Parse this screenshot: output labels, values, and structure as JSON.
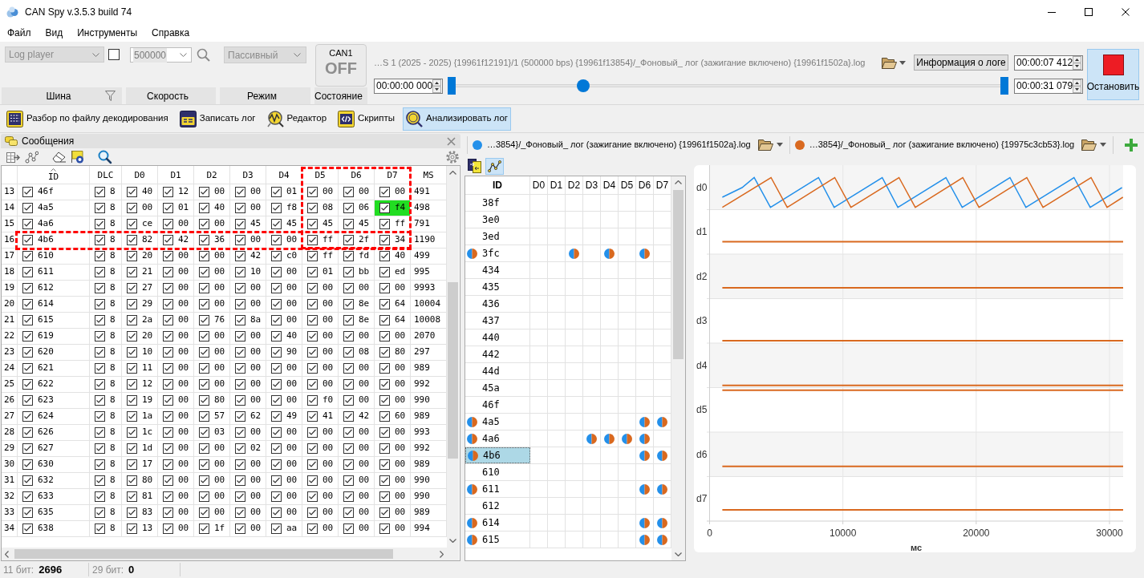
{
  "window": {
    "title": "CAN Spy v.3.5.3 build 74"
  },
  "menu": [
    {
      "label": "Файл"
    },
    {
      "label": "Вид"
    },
    {
      "label": "Инструменты"
    },
    {
      "label": "Справка"
    }
  ],
  "ribbon": {
    "bus": {
      "value": "Log player",
      "disabled": true,
      "checked": false,
      "label": "Шина"
    },
    "speed": {
      "value": "500000",
      "disabled": false,
      "label": "Скорость"
    },
    "mode": {
      "value": "Пассивный",
      "disabled": true,
      "label": "Режим"
    },
    "state": {
      "channel": "CAN1",
      "status": "OFF",
      "on": false,
      "label": "Состояние"
    },
    "player": {
      "path": "…S 1 (2025 - 2025) {19961f12191}/1 (500000 bps) {19961f13854}/_Фоновый_ лог (зажигание включено) {19961f1502a}.log",
      "info_button": "Информация о логе",
      "current_time": "00:00:07 412",
      "start_time": "00:00:00 000",
      "end_time": "00:00:31 079",
      "range_start": {
        "level": 0
      },
      "position": {
        "level": 0.2385
      },
      "range_end": {
        "level": 1
      }
    },
    "stop_button": {
      "label": "Остановить"
    }
  },
  "toolbar": [
    {
      "label": "Разбор по файлу декодирования",
      "kind": "decode",
      "selected": false
    },
    {
      "label": "Записать лог",
      "kind": "record",
      "selected": false
    },
    {
      "label": "Редактор",
      "kind": "editor",
      "selected": false
    },
    {
      "label": "Скрипты",
      "kind": "scripts",
      "selected": false
    },
    {
      "label": "Анализировать лог",
      "kind": "analyze",
      "selected": true
    }
  ],
  "messages": {
    "title": "Сообщения",
    "columns": [
      {
        "label": "ID",
        "sorted": true,
        "outlined": false
      },
      {
        "label": "DLC",
        "sorted": false,
        "outlined": false
      },
      {
        "label": "D0",
        "sorted": false,
        "outlined": false
      },
      {
        "label": "D1",
        "sorted": false,
        "outlined": false
      },
      {
        "label": "D2",
        "sorted": false,
        "outlined": false
      },
      {
        "label": "D3",
        "sorted": false,
        "outlined": false
      },
      {
        "label": "D4",
        "sorted": false,
        "outlined": false
      },
      {
        "label": "D5",
        "sorted": false,
        "outlined": true
      },
      {
        "label": "D6",
        "sorted": false,
        "outlined": true
      },
      {
        "label": "D7",
        "sorted": false,
        "outlined": true
      },
      {
        "label": "MS",
        "sorted": false,
        "outlined": false
      }
    ],
    "rows": [
      {
        "num": "13",
        "id": "46f",
        "dlc": "8",
        "bytes": [
          "40",
          "12",
          "00",
          "00",
          "01",
          "00",
          "00",
          "00"
        ],
        "ms": "491",
        "checked": true,
        "changed": [
          false,
          false,
          false,
          false,
          false,
          false,
          false,
          false
        ],
        "outlined": false
      },
      {
        "num": "14",
        "id": "4a5",
        "dlc": "8",
        "bytes": [
          "00",
          "01",
          "40",
          "00",
          "f8",
          "08",
          "06",
          "f4"
        ],
        "ms": "498",
        "checked": true,
        "changed": [
          false,
          false,
          false,
          false,
          false,
          false,
          false,
          true
        ],
        "outlined": false
      },
      {
        "num": "15",
        "id": "4a6",
        "dlc": "8",
        "bytes": [
          "ce",
          "00",
          "00",
          "45",
          "45",
          "45",
          "45",
          "ff"
        ],
        "ms": "791",
        "checked": true,
        "changed": [
          false,
          false,
          false,
          false,
          false,
          false,
          false,
          false
        ],
        "outlined": false
      },
      {
        "num": "16",
        "id": "4b6",
        "dlc": "8",
        "bytes": [
          "82",
          "42",
          "36",
          "00",
          "00",
          "ff",
          "2f",
          "34"
        ],
        "ms": "1190",
        "checked": true,
        "changed": [
          false,
          false,
          false,
          false,
          false,
          false,
          false,
          false
        ],
        "outlined": true
      },
      {
        "num": "17",
        "id": "610",
        "dlc": "8",
        "bytes": [
          "20",
          "00",
          "00",
          "42",
          "c0",
          "ff",
          "fd",
          "40"
        ],
        "ms": "499",
        "checked": true,
        "changed": [
          false,
          false,
          false,
          false,
          false,
          false,
          false,
          false
        ],
        "outlined": false
      },
      {
        "num": "18",
        "id": "611",
        "dlc": "8",
        "bytes": [
          "21",
          "00",
          "00",
          "10",
          "00",
          "01",
          "bb",
          "ed"
        ],
        "ms": "995",
        "checked": true,
        "changed": [
          false,
          false,
          false,
          false,
          false,
          false,
          false,
          false
        ],
        "outlined": false
      },
      {
        "num": "19",
        "id": "612",
        "dlc": "8",
        "bytes": [
          "27",
          "00",
          "00",
          "00",
          "00",
          "00",
          "00",
          "00"
        ],
        "ms": "9993",
        "checked": true,
        "changed": [
          false,
          false,
          false,
          false,
          false,
          false,
          false,
          false
        ],
        "outlined": false
      },
      {
        "num": "20",
        "id": "614",
        "dlc": "8",
        "bytes": [
          "29",
          "00",
          "00",
          "00",
          "00",
          "00",
          "8e",
          "64"
        ],
        "ms": "10004",
        "checked": true,
        "changed": [
          false,
          false,
          false,
          false,
          false,
          false,
          false,
          false
        ],
        "outlined": false
      },
      {
        "num": "21",
        "id": "615",
        "dlc": "8",
        "bytes": [
          "2a",
          "00",
          "76",
          "8a",
          "00",
          "00",
          "8e",
          "64"
        ],
        "ms": "10008",
        "checked": true,
        "changed": [
          false,
          false,
          false,
          false,
          false,
          false,
          false,
          false
        ],
        "outlined": false
      },
      {
        "num": "22",
        "id": "619",
        "dlc": "8",
        "bytes": [
          "20",
          "00",
          "00",
          "00",
          "40",
          "00",
          "00",
          "00"
        ],
        "ms": "2070",
        "checked": true,
        "changed": [
          false,
          false,
          false,
          false,
          false,
          false,
          false,
          false
        ],
        "outlined": false
      },
      {
        "num": "23",
        "id": "620",
        "dlc": "8",
        "bytes": [
          "10",
          "00",
          "00",
          "00",
          "90",
          "00",
          "08",
          "80"
        ],
        "ms": "297",
        "checked": true,
        "changed": [
          false,
          false,
          false,
          false,
          false,
          false,
          false,
          false
        ],
        "outlined": false
      },
      {
        "num": "24",
        "id": "621",
        "dlc": "8",
        "bytes": [
          "11",
          "00",
          "00",
          "00",
          "00",
          "00",
          "00",
          "00"
        ],
        "ms": "989",
        "checked": true,
        "changed": [
          false,
          false,
          false,
          false,
          false,
          false,
          false,
          false
        ],
        "outlined": false
      },
      {
        "num": "25",
        "id": "622",
        "dlc": "8",
        "bytes": [
          "12",
          "00",
          "00",
          "00",
          "00",
          "00",
          "00",
          "00"
        ],
        "ms": "992",
        "checked": true,
        "changed": [
          false,
          false,
          false,
          false,
          false,
          false,
          false,
          false
        ],
        "outlined": false
      },
      {
        "num": "26",
        "id": "623",
        "dlc": "8",
        "bytes": [
          "19",
          "00",
          "80",
          "00",
          "00",
          "f0",
          "00",
          "00"
        ],
        "ms": "990",
        "checked": true,
        "changed": [
          false,
          false,
          false,
          false,
          false,
          false,
          false,
          false
        ],
        "outlined": false
      },
      {
        "num": "27",
        "id": "624",
        "dlc": "8",
        "bytes": [
          "1a",
          "00",
          "57",
          "62",
          "49",
          "41",
          "42",
          "60"
        ],
        "ms": "989",
        "checked": true,
        "changed": [
          false,
          false,
          false,
          false,
          false,
          false,
          false,
          false
        ],
        "outlined": false
      },
      {
        "num": "28",
        "id": "626",
        "dlc": "8",
        "bytes": [
          "1c",
          "00",
          "03",
          "00",
          "00",
          "00",
          "00",
          "00"
        ],
        "ms": "993",
        "checked": true,
        "changed": [
          false,
          false,
          false,
          false,
          false,
          false,
          false,
          false
        ],
        "outlined": false
      },
      {
        "num": "29",
        "id": "627",
        "dlc": "8",
        "bytes": [
          "1d",
          "00",
          "00",
          "02",
          "00",
          "00",
          "00",
          "00"
        ],
        "ms": "992",
        "checked": true,
        "changed": [
          false,
          false,
          false,
          false,
          false,
          false,
          false,
          false
        ],
        "outlined": false
      },
      {
        "num": "30",
        "id": "630",
        "dlc": "8",
        "bytes": [
          "17",
          "00",
          "00",
          "00",
          "00",
          "00",
          "00",
          "00"
        ],
        "ms": "989",
        "checked": true,
        "changed": [
          false,
          false,
          false,
          false,
          false,
          false,
          false,
          false
        ],
        "outlined": false
      },
      {
        "num": "31",
        "id": "632",
        "dlc": "8",
        "bytes": [
          "80",
          "00",
          "00",
          "00",
          "00",
          "00",
          "00",
          "00"
        ],
        "ms": "990",
        "checked": true,
        "changed": [
          false,
          false,
          false,
          false,
          false,
          false,
          false,
          false
        ],
        "outlined": false
      },
      {
        "num": "32",
        "id": "633",
        "dlc": "8",
        "bytes": [
          "81",
          "00",
          "00",
          "00",
          "00",
          "00",
          "00",
          "00"
        ],
        "ms": "990",
        "checked": true,
        "changed": [
          false,
          false,
          false,
          false,
          false,
          false,
          false,
          false
        ],
        "outlined": false
      },
      {
        "num": "33",
        "id": "635",
        "dlc": "8",
        "bytes": [
          "83",
          "00",
          "00",
          "00",
          "00",
          "00",
          "00",
          "00"
        ],
        "ms": "989",
        "checked": true,
        "changed": [
          false,
          false,
          false,
          false,
          false,
          false,
          false,
          false
        ],
        "outlined": false
      },
      {
        "num": "34",
        "id": "638",
        "dlc": "8",
        "bytes": [
          "13",
          "00",
          "1f",
          "00",
          "aa",
          "00",
          "00",
          "00"
        ],
        "ms": "994",
        "checked": true,
        "changed": [
          false,
          false,
          false,
          false,
          false,
          false,
          false,
          false
        ],
        "outlined": false
      }
    ]
  },
  "status_bar": [
    {
      "label": "11 бит:",
      "value": "2696"
    },
    {
      "label": "29 бит:",
      "value": "0"
    }
  ],
  "compare": {
    "logs": [
      {
        "name": "…3854}/_Фоновый_ лог (зажигание включено) {19961f1502a}.log",
        "color": "#2490ea"
      },
      {
        "name": "…3854}/_Фоновый_ лог (зажигание включено) {19975c3cb53}.log",
        "color": "#d9691f"
      }
    ],
    "views": [
      {
        "kind": "table",
        "selected": false
      },
      {
        "kind": "chart",
        "selected": true
      }
    ],
    "columns": [
      "ID",
      "D0",
      "D1",
      "D2",
      "D3",
      "D4",
      "D5",
      "D6",
      "D7"
    ],
    "rows": [
      {
        "id": "38f",
        "marked": false,
        "selected": false,
        "diff": [
          false,
          false,
          false,
          false,
          false,
          false,
          false,
          false
        ]
      },
      {
        "id": "3e0",
        "marked": false,
        "selected": false,
        "diff": [
          false,
          false,
          false,
          false,
          false,
          false,
          false,
          false
        ]
      },
      {
        "id": "3ed",
        "marked": false,
        "selected": false,
        "diff": [
          false,
          false,
          false,
          false,
          false,
          false,
          false,
          false
        ]
      },
      {
        "id": "3fc",
        "marked": true,
        "selected": false,
        "diff": [
          false,
          false,
          true,
          false,
          true,
          false,
          true,
          false
        ]
      },
      {
        "id": "434",
        "marked": false,
        "selected": false,
        "diff": [
          false,
          false,
          false,
          false,
          false,
          false,
          false,
          false
        ]
      },
      {
        "id": "435",
        "marked": false,
        "selected": false,
        "diff": [
          false,
          false,
          false,
          false,
          false,
          false,
          false,
          false
        ]
      },
      {
        "id": "436",
        "marked": false,
        "selected": false,
        "diff": [
          false,
          false,
          false,
          false,
          false,
          false,
          false,
          false
        ]
      },
      {
        "id": "437",
        "marked": false,
        "selected": false,
        "diff": [
          false,
          false,
          false,
          false,
          false,
          false,
          false,
          false
        ]
      },
      {
        "id": "440",
        "marked": false,
        "selected": false,
        "diff": [
          false,
          false,
          false,
          false,
          false,
          false,
          false,
          false
        ]
      },
      {
        "id": "442",
        "marked": false,
        "selected": false,
        "diff": [
          false,
          false,
          false,
          false,
          false,
          false,
          false,
          false
        ]
      },
      {
        "id": "44d",
        "marked": false,
        "selected": false,
        "diff": [
          false,
          false,
          false,
          false,
          false,
          false,
          false,
          false
        ]
      },
      {
        "id": "45a",
        "marked": false,
        "selected": false,
        "diff": [
          false,
          false,
          false,
          false,
          false,
          false,
          false,
          false
        ]
      },
      {
        "id": "46f",
        "marked": false,
        "selected": false,
        "diff": [
          false,
          false,
          false,
          false,
          false,
          false,
          false,
          false
        ]
      },
      {
        "id": "4a5",
        "marked": true,
        "selected": false,
        "diff": [
          false,
          false,
          false,
          false,
          false,
          false,
          true,
          true
        ]
      },
      {
        "id": "4a6",
        "marked": true,
        "selected": false,
        "diff": [
          false,
          false,
          false,
          true,
          true,
          true,
          true,
          false
        ]
      },
      {
        "id": "4b6",
        "marked": true,
        "selected": true,
        "diff": [
          false,
          false,
          false,
          false,
          false,
          false,
          true,
          true
        ]
      },
      {
        "id": "610",
        "marked": false,
        "selected": false,
        "diff": [
          false,
          false,
          false,
          false,
          false,
          false,
          false,
          false
        ]
      },
      {
        "id": "611",
        "marked": true,
        "selected": false,
        "diff": [
          false,
          false,
          false,
          false,
          false,
          false,
          true,
          true
        ]
      },
      {
        "id": "612",
        "marked": false,
        "selected": false,
        "diff": [
          false,
          false,
          false,
          false,
          false,
          false,
          false,
          false
        ]
      },
      {
        "id": "614",
        "marked": true,
        "selected": false,
        "diff": [
          false,
          false,
          false,
          false,
          false,
          false,
          true,
          true
        ]
      },
      {
        "id": "615",
        "marked": true,
        "selected": false,
        "diff": [
          false,
          false,
          false,
          false,
          false,
          false,
          true,
          true
        ]
      }
    ]
  },
  "chart": {
    "lanes": [
      {
        "label": "d0",
        "kind": "wave"
      },
      {
        "label": "d1",
        "kind": "flat"
      },
      {
        "label": "d2",
        "kind": "flat"
      },
      {
        "label": "d3",
        "kind": "flat"
      },
      {
        "label": "d4",
        "kind": "flat"
      },
      {
        "label": "d5",
        "kind": "flat"
      },
      {
        "label": "d6",
        "kind": "flat"
      },
      {
        "label": "d7",
        "kind": "flat"
      }
    ],
    "x_ticks": [
      "0",
      "10000",
      "20000",
      "30000"
    ],
    "x_label": "мс"
  }
}
